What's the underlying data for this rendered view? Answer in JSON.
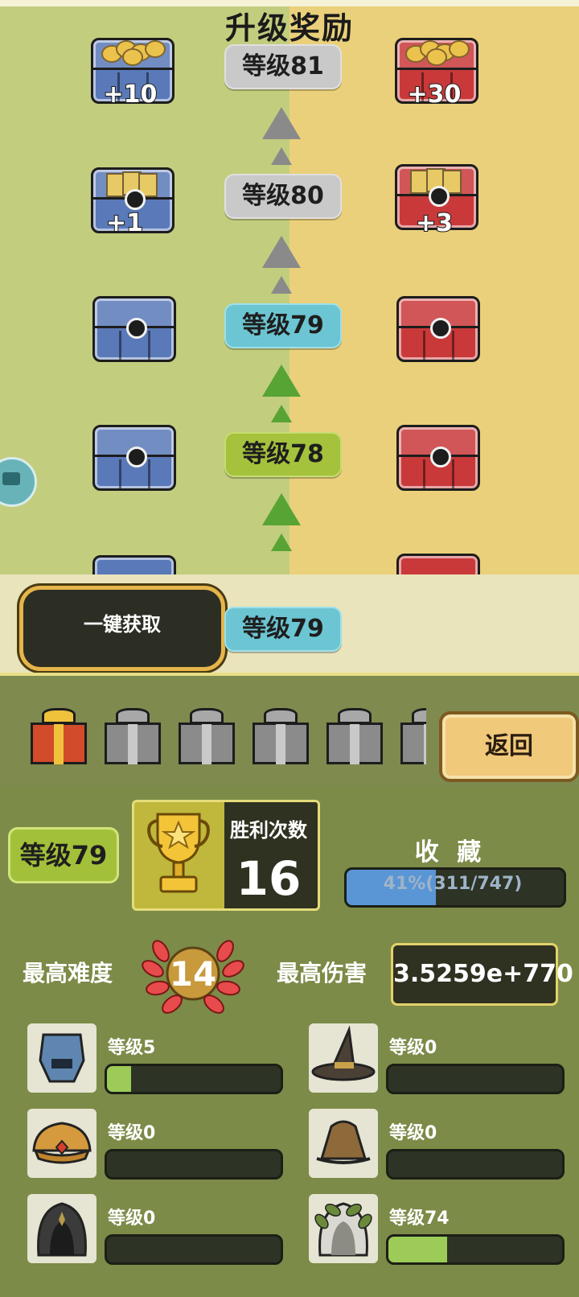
{
  "title": "升级奖励",
  "track": [
    {
      "level_label": "等级81",
      "state": "locked",
      "left_reward": "+10",
      "right_reward": "+30",
      "reward_kind": "coins"
    },
    {
      "level_label": "等级80",
      "state": "locked",
      "left_reward": "+1",
      "right_reward": "+3",
      "reward_kind": "cards"
    },
    {
      "level_label": "等级79",
      "state": "current",
      "left_reward": "",
      "right_reward": "",
      "reward_kind": "chest"
    },
    {
      "level_label": "等级78",
      "state": "reached",
      "left_reward": "",
      "right_reward": "",
      "reward_kind": "chest"
    }
  ],
  "claim": {
    "button_label": "一键获取",
    "current_level_label": "等级79"
  },
  "gift_boxes": [
    "gold",
    "gray",
    "gray",
    "gray",
    "gray",
    "gray"
  ],
  "return_label": "返回",
  "stats": {
    "player_level": "等级79",
    "wins_label": "胜利次数",
    "wins_value": "16",
    "collection_label": "收 藏",
    "collection_text": "41%(311/747)",
    "collection_progress": 0.41,
    "max_difficulty_label": "最高难度",
    "max_difficulty_value": "14",
    "max_damage_label": "最高伤害",
    "max_damage_value": "3.5259e+770"
  },
  "equipment": [
    {
      "name": "knight-helmet-icon",
      "level_label": "等级5",
      "progress": 0.14
    },
    {
      "name": "witch-hat-icon",
      "level_label": "等级0",
      "progress": 0.0
    },
    {
      "name": "turban-icon",
      "level_label": "等级0",
      "progress": 0.0
    },
    {
      "name": "leather-hat-icon",
      "level_label": "等级0",
      "progress": 0.0
    },
    {
      "name": "dark-hood-icon",
      "level_label": "等级0",
      "progress": 0.0
    },
    {
      "name": "laurel-hood-icon",
      "level_label": "等级74",
      "progress": 0.34
    }
  ],
  "colors": {
    "accent_green": "#a3c03a",
    "accent_cyan": "#6cc5d2",
    "bar_blue": "#5a96d6",
    "bar_green": "#9ccb57"
  }
}
